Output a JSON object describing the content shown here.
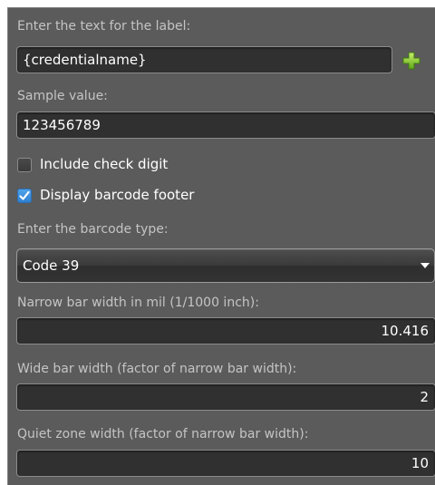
{
  "label_text": {
    "caption": "Enter the text for the label:",
    "value": "{credentialname}",
    "add_icon": "plus-icon"
  },
  "sample": {
    "caption": "Sample value:",
    "value": "123456789"
  },
  "checkboxes": {
    "check_digit": {
      "label": "Include check digit",
      "checked": false
    },
    "display_footer": {
      "label": "Display barcode footer",
      "checked": true
    }
  },
  "barcode_type": {
    "caption": "Enter the barcode type:",
    "selected": "Code 39"
  },
  "narrow_bar": {
    "caption": "Narrow bar width in mil (1/1000 inch):",
    "value": "10.416"
  },
  "wide_bar": {
    "caption": "Wide bar width (factor of narrow bar width):",
    "value": "2"
  },
  "quiet_zone": {
    "caption": "Quiet zone width (factor of narrow bar width):",
    "value": "10"
  },
  "colors": {
    "panel_bg": "#5b5b5b",
    "field_bg": "#303030",
    "caption_text": "#c4c4c4",
    "checkbox_accent": "#3a8ede",
    "plus_icon": "#8ccf2a"
  }
}
